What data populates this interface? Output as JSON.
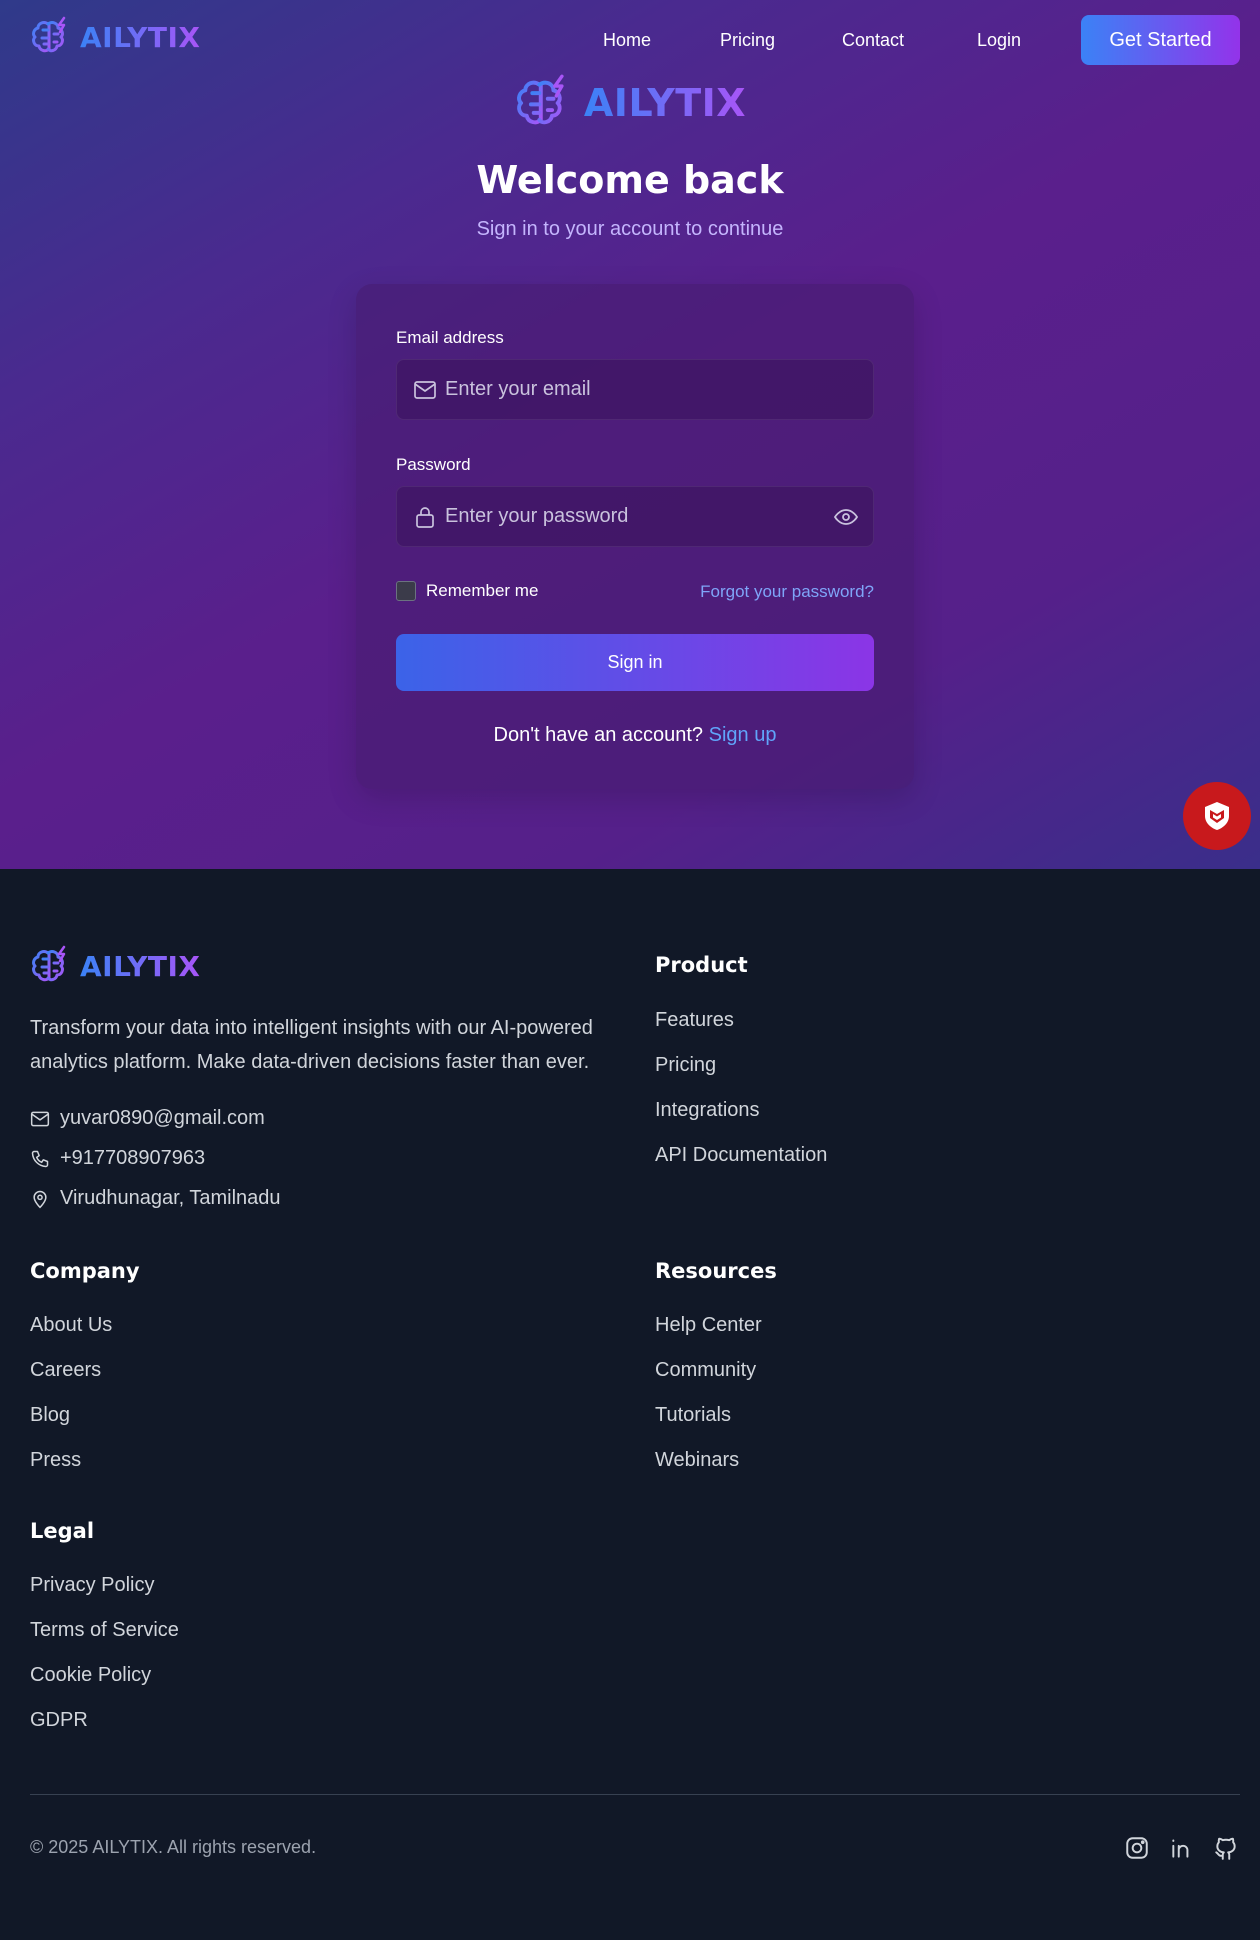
{
  "brand": {
    "name": "AILYTIX",
    "gradient_from": "#3b82f6",
    "gradient_to": "#a855f7"
  },
  "nav": {
    "links": [
      {
        "label": "Home",
        "icon": ""
      },
      {
        "label": "Pricing",
        "icon": ""
      },
      {
        "label": "Contact",
        "icon": ""
      },
      {
        "label": "Login",
        "icon": ""
      }
    ],
    "cta_label": "Get Started"
  },
  "login": {
    "title": "Welcome back",
    "subtitle": "Sign in to your account to continue",
    "email_label": "Email address",
    "email_placeholder": "Enter your email",
    "email_value": "",
    "password_label": "Password",
    "password_placeholder": "Enter your password",
    "password_value": "",
    "remember_label": "Remember me",
    "remember_checked": false,
    "forgot_label": "Forgot your password?",
    "signin_label": "Sign in",
    "no_account_text": "Don't have an account?",
    "signup_label": "Sign up",
    "icons": {
      "email": "mail-icon",
      "password": "lock-icon",
      "toggle": "eye-icon"
    }
  },
  "badge": {
    "icon": "shield-icon",
    "color": "#c8191c"
  },
  "footer": {
    "description": "Transform your data into intelligent insights with our AI-powered analytics platform. Make data-driven decisions faster than ever.",
    "contact": {
      "email": "yuvar0890@gmail.com",
      "phone": "+917708907963",
      "location": "Virudhunagar, Tamilnadu"
    },
    "product": {
      "title": "Product",
      "links": [
        "Features",
        "Pricing",
        "Integrations",
        "API Documentation"
      ]
    },
    "company": {
      "title": "Company",
      "links": [
        "About Us",
        "Careers",
        "Blog",
        "Press"
      ]
    },
    "resources": {
      "title": "Resources",
      "links": [
        "Help Center",
        "Community",
        "Tutorials",
        "Webinars"
      ]
    },
    "legal": {
      "title": "Legal",
      "links": [
        "Privacy Policy",
        "Terms of Service",
        "Cookie Policy",
        "GDPR"
      ]
    },
    "copyright": "© 2025 AILYTIX. All rights reserved.",
    "social": [
      "instagram-icon",
      "linkedin-icon",
      "github-icon"
    ]
  }
}
